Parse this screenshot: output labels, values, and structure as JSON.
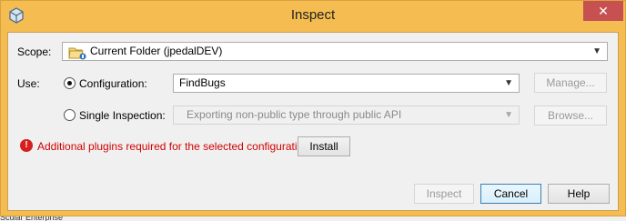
{
  "window": {
    "title": "Inspect",
    "close_glyph": "✕",
    "accent_color": "#f4bc51",
    "close_color": "#c75050"
  },
  "scope": {
    "label": "Scope:",
    "value": "Current Folder (jpedalDEV)",
    "icon": "folder-icon"
  },
  "use": {
    "label": "Use:",
    "configuration": {
      "label": "Configuration:",
      "checked": true,
      "value": "FindBugs",
      "manage_label": "Manage..."
    },
    "single_inspection": {
      "label": "Single Inspection:",
      "checked": false,
      "value": "Exporting non-public type through public API",
      "browse_label": "Browse..."
    }
  },
  "error": {
    "icon": "error-icon",
    "message": "Additional plugins required for the selected configuration.",
    "install_label": "Install"
  },
  "buttons": {
    "inspect": "Inspect",
    "cancel": "Cancel",
    "help": "Help"
  },
  "background": {
    "bottom_text": "Scular Enterprise"
  }
}
